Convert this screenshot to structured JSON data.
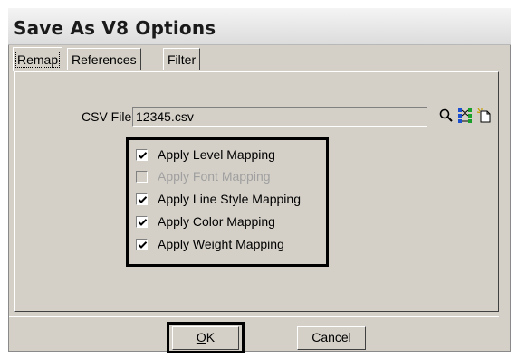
{
  "window": {
    "title": "Save As V8 Options"
  },
  "tabs": [
    {
      "label": "Remap",
      "active": true
    },
    {
      "label": "References",
      "active": false
    },
    {
      "label": "Filter",
      "active": false
    }
  ],
  "csv": {
    "label": "CSV File",
    "value": "12345.csv"
  },
  "icons": [
    "search-icon",
    "map-icon",
    "new-file-icon"
  ],
  "options": [
    {
      "label": "Apply Level Mapping",
      "checked": true,
      "enabled": true
    },
    {
      "label": "Apply Font Mapping",
      "checked": false,
      "enabled": false
    },
    {
      "label": "Apply Line Style Mapping",
      "checked": true,
      "enabled": true
    },
    {
      "label": "Apply Color Mapping",
      "checked": true,
      "enabled": true
    },
    {
      "label": "Apply Weight Mapping",
      "checked": true,
      "enabled": true
    }
  ],
  "buttons": {
    "ok": {
      "mnemonic": "O",
      "rest": "K"
    },
    "cancel": "Cancel"
  },
  "colors": {
    "dialog_bg": "#d4d0c8",
    "highlight_frame": "#000000",
    "disabled_text": "#a0a0a0"
  }
}
